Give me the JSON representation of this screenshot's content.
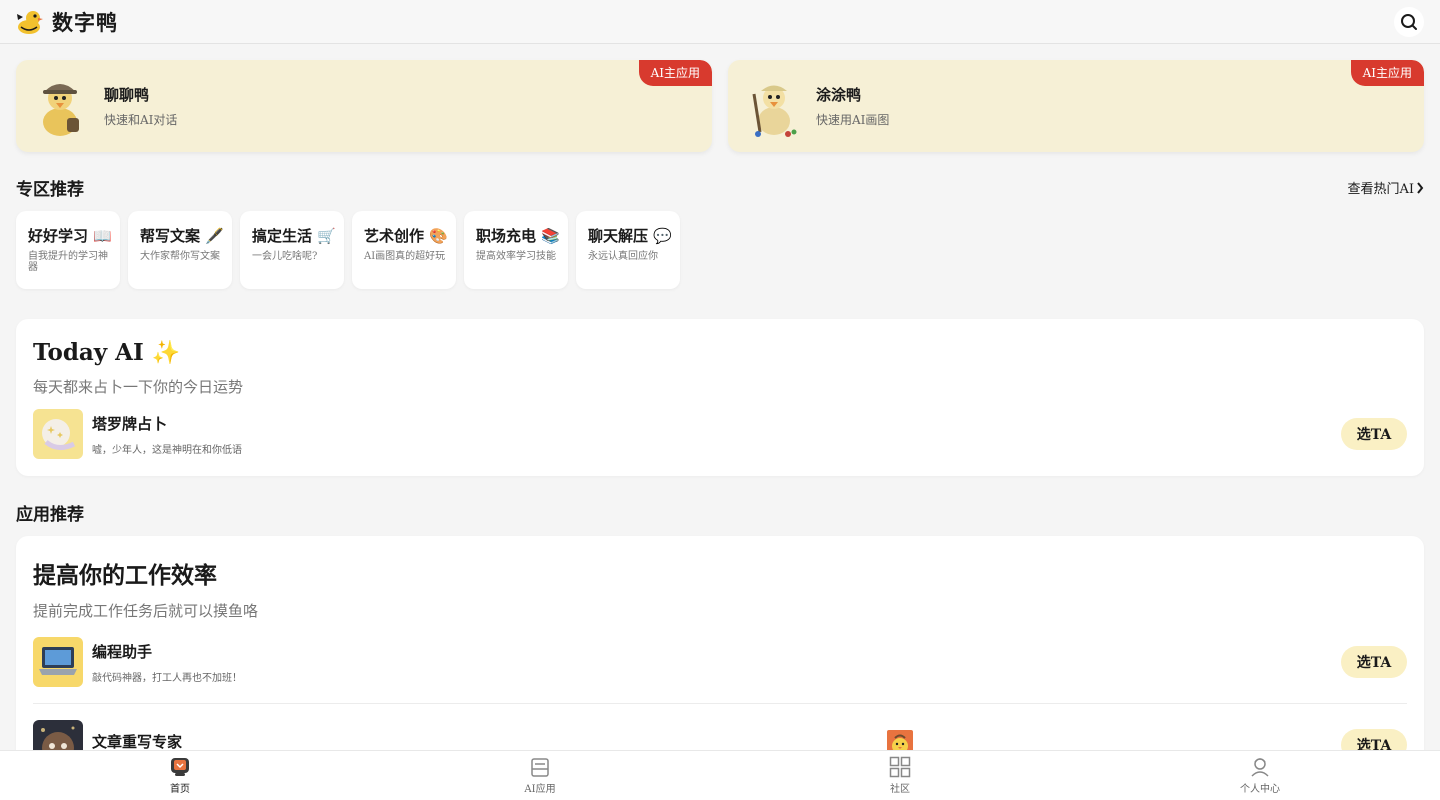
{
  "header": {
    "logo_text": "数字鸭"
  },
  "top_apps": [
    {
      "title": "聊聊鸭",
      "subtitle": "快速和AI对话",
      "tag": "AI主应用"
    },
    {
      "title": "涂涂鸭",
      "subtitle": "快速用AI画图",
      "tag": "AI主应用"
    }
  ],
  "zones_section": {
    "title": "专区推荐",
    "link": "查看热门AI",
    "items": [
      {
        "title": "好好学习 📖",
        "subtitle": "自我提升的学习神器"
      },
      {
        "title": "帮写文案 🖋️",
        "subtitle": "大作家帮你写文案"
      },
      {
        "title": "搞定生活 🛒",
        "subtitle": "一会儿吃啥呢?"
      },
      {
        "title": "艺术创作 🎨",
        "subtitle": "AI画图真的超好玩"
      },
      {
        "title": "职场充电 📚",
        "subtitle": "提高效率学习技能"
      },
      {
        "title": "聊天解压 💬",
        "subtitle": "永远认真回应你"
      }
    ]
  },
  "today": {
    "title": "Today AI ✨",
    "subtitle": "每天都来占卜一下你的今日运势",
    "app": {
      "name": "塔罗牌占卜",
      "desc": "嘘，少年人，这是神明在和你低语",
      "button": "选TA"
    }
  },
  "apps_section": {
    "title": "应用推荐",
    "panel_title": "提高你的工作效率",
    "panel_subtitle": "提前完成工作任务后就可以摸鱼咯",
    "apps": [
      {
        "name": "编程助手",
        "desc": "敲代码神器，打工人再也不加班！",
        "button": "选TA"
      },
      {
        "name": "文章重写专家",
        "desc": "",
        "button": "选TA"
      }
    ]
  },
  "nav": [
    {
      "label": "首页"
    },
    {
      "label": "AI应用"
    },
    {
      "label": "社区"
    },
    {
      "label": "个人中心"
    }
  ],
  "colors": {
    "accent_cream": "#f6f0d6",
    "tag_red": "#d83a2e",
    "button_bg": "#faf0c4"
  }
}
